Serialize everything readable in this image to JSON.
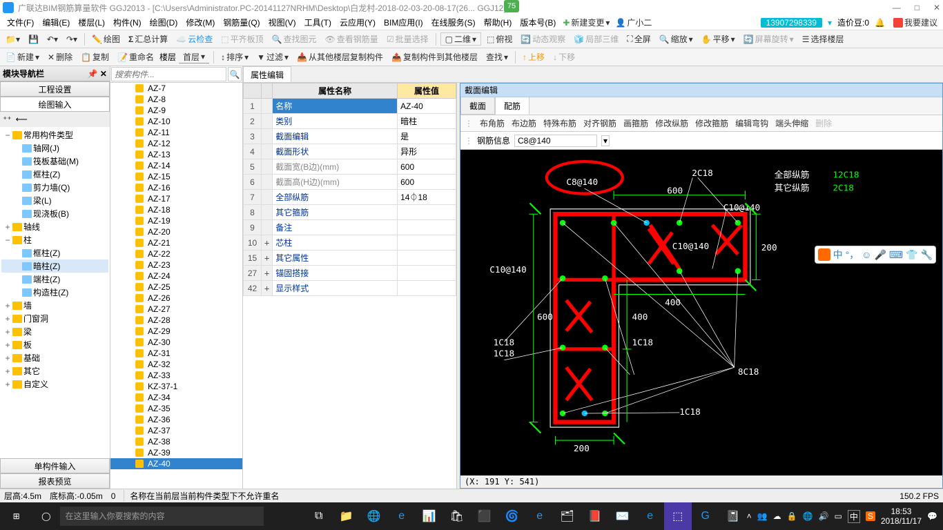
{
  "title": "广联达BIM钢筋算量软件 GGJ2013 - [C:\\Users\\Administrator.PC-20141127NRHM\\Desktop\\白龙村-2018-02-03-20-08-17(26... GGJ12]",
  "badge": "75",
  "win_controls": {
    "min": "—",
    "max": "□",
    "close": "✕"
  },
  "menubar": [
    "文件(F)",
    "编辑(E)",
    "楼层(L)",
    "构件(N)",
    "绘图(D)",
    "修改(M)",
    "钢筋量(Q)",
    "视图(V)",
    "工具(T)",
    "云应用(Y)",
    "BIM应用(I)",
    "在线服务(S)",
    "帮助(H)",
    "版本号(B)"
  ],
  "menubar_right": {
    "new_change": "新建变更",
    "user": "广小二",
    "phone": "13907298339",
    "price_label": "造价豆:0",
    "suggest": "我要建议"
  },
  "toolbar1": [
    "绘图",
    "汇总计算",
    "云检查",
    "平齐板顶",
    "查找图元",
    "查看钢筋量",
    "批量选择",
    "二维",
    "俯视",
    "动态观察",
    "局部三维",
    "全屏",
    "缩放",
    "平移",
    "屏幕旋转",
    "选择楼层"
  ],
  "toolbar2": {
    "new": "新建",
    "delete": "删除",
    "copy": "复制",
    "rename": "重命名",
    "floor": "楼层",
    "first": "首层",
    "sort": "排序",
    "filter": "过滤",
    "copy_from": "从其他楼层复制构件",
    "copy_to": "复制构件到其他楼层",
    "find": "查找",
    "up": "上移",
    "down": "下移"
  },
  "left_panel": {
    "header": "模块导航栏",
    "btn1": "工程设置",
    "btn2": "绘图输入",
    "btn3": "单构件输入",
    "btn4": "报表预览",
    "tree": [
      {
        "lvl": 1,
        "exp": "−",
        "label": "常用构件类型"
      },
      {
        "lvl": 2,
        "exp": "",
        "label": "轴网(J)",
        "icon": "grid"
      },
      {
        "lvl": 2,
        "exp": "",
        "label": "筏板基础(M)",
        "icon": "raft"
      },
      {
        "lvl": 2,
        "exp": "",
        "label": "框柱(Z)",
        "icon": "col"
      },
      {
        "lvl": 2,
        "exp": "",
        "label": "剪力墙(Q)",
        "icon": "wall"
      },
      {
        "lvl": 2,
        "exp": "",
        "label": "梁(L)",
        "icon": "beam"
      },
      {
        "lvl": 2,
        "exp": "",
        "label": "现浇板(B)",
        "icon": "slab"
      },
      {
        "lvl": 1,
        "exp": "+",
        "label": "轴线"
      },
      {
        "lvl": 1,
        "exp": "−",
        "label": "柱"
      },
      {
        "lvl": 2,
        "exp": "",
        "label": "框柱(Z)",
        "icon": "col"
      },
      {
        "lvl": 2,
        "exp": "",
        "label": "暗柱(Z)",
        "icon": "col",
        "sel": true
      },
      {
        "lvl": 2,
        "exp": "",
        "label": "端柱(Z)",
        "icon": "col"
      },
      {
        "lvl": 2,
        "exp": "",
        "label": "构造柱(Z)",
        "icon": "col"
      },
      {
        "lvl": 1,
        "exp": "+",
        "label": "墙"
      },
      {
        "lvl": 1,
        "exp": "+",
        "label": "门窗洞"
      },
      {
        "lvl": 1,
        "exp": "+",
        "label": "梁"
      },
      {
        "lvl": 1,
        "exp": "+",
        "label": "板"
      },
      {
        "lvl": 1,
        "exp": "+",
        "label": "基础"
      },
      {
        "lvl": 1,
        "exp": "+",
        "label": "其它"
      },
      {
        "lvl": 1,
        "exp": "+",
        "label": "自定义"
      }
    ]
  },
  "search_placeholder": "搜索构件...",
  "components": [
    "AZ-7",
    "AZ-8",
    "AZ-9",
    "AZ-10",
    "AZ-11",
    "AZ-12",
    "AZ-13",
    "AZ-14",
    "AZ-15",
    "AZ-16",
    "AZ-17",
    "AZ-18",
    "AZ-19",
    "AZ-20",
    "AZ-21",
    "AZ-22",
    "AZ-23",
    "AZ-24",
    "AZ-25",
    "AZ-26",
    "AZ-27",
    "AZ-28",
    "AZ-29",
    "AZ-30",
    "AZ-31",
    "AZ-32",
    "AZ-33",
    "KZ-37-1",
    "AZ-34",
    "AZ-35",
    "AZ-36",
    "AZ-37",
    "AZ-38",
    "AZ-39",
    "AZ-40"
  ],
  "selected_component": "AZ-40",
  "prop_tab": "属性编辑",
  "prop_headers": {
    "name": "属性名称",
    "value": "属性值"
  },
  "prop_rows": [
    {
      "n": "1",
      "name": "名称",
      "val": "AZ-40",
      "sel": true
    },
    {
      "n": "2",
      "name": "类别",
      "val": "暗柱"
    },
    {
      "n": "3",
      "name": "截面编辑",
      "val": "是"
    },
    {
      "n": "4",
      "name": "截面形状",
      "val": "异形"
    },
    {
      "n": "5",
      "name": "截面宽(B边)(mm)",
      "val": "600",
      "gray": true
    },
    {
      "n": "6",
      "name": "截面高(H边)(mm)",
      "val": "600",
      "gray": true
    },
    {
      "n": "7",
      "name": "全部纵筋",
      "val": "14⏀18"
    },
    {
      "n": "8",
      "name": "其它箍筋",
      "val": ""
    },
    {
      "n": "9",
      "name": "备注",
      "val": ""
    },
    {
      "n": "10",
      "name": "芯柱",
      "val": "",
      "exp": "+"
    },
    {
      "n": "15",
      "name": "其它属性",
      "val": "",
      "exp": "+"
    },
    {
      "n": "27",
      "name": "锚固搭接",
      "val": "",
      "exp": "+"
    },
    {
      "n": "42",
      "name": "显示样式",
      "val": "",
      "exp": "+"
    }
  ],
  "section": {
    "title": "截面编辑",
    "tabs": [
      "截面",
      "配筋"
    ],
    "active_tab": "配筋",
    "toolbar": [
      "布角筋",
      "布边筋",
      "特殊布筋",
      "对齐钢筋",
      "画箍筋",
      "修改纵筋",
      "修改箍筋",
      "编辑弯钩",
      "端头伸缩",
      "删除"
    ],
    "info_label": "钢筋信息",
    "info_value": "C8@140",
    "coords": "(X: 191 Y: 541)",
    "svg_labels": {
      "c8140": "C8@140",
      "c2c18": "2C18",
      "c109140": "C10@140",
      "d600_t": "600",
      "d200": "200",
      "d400_r": "400",
      "d400_b": "400",
      "d600_l": "600",
      "d200_b": "200",
      "c10140_l": "C10@140",
      "c10140_m": "C10@140",
      "l1c18a": "1C18",
      "l1c18b": "1C18",
      "l1c18c": "1C18",
      "l1c18d": "1C18",
      "l8c18": "8C18",
      "leg1": "全部纵筋",
      "leg1v": "12C18",
      "leg2": "其它纵筋",
      "leg2v": "2C18"
    }
  },
  "statusbar": {
    "floor_h": "层高:4.5m",
    "bottom": "底标高:-0.05m",
    "zero": "0",
    "msg": "名称在当前层当前构件类型下不允许重名",
    "fps": "150.2 FPS"
  },
  "taskbar": {
    "search": "在这里输入你要搜索的内容",
    "time": "18:53",
    "date": "2018/11/17",
    "ime": "中"
  },
  "ime": {
    "ch": "中"
  }
}
